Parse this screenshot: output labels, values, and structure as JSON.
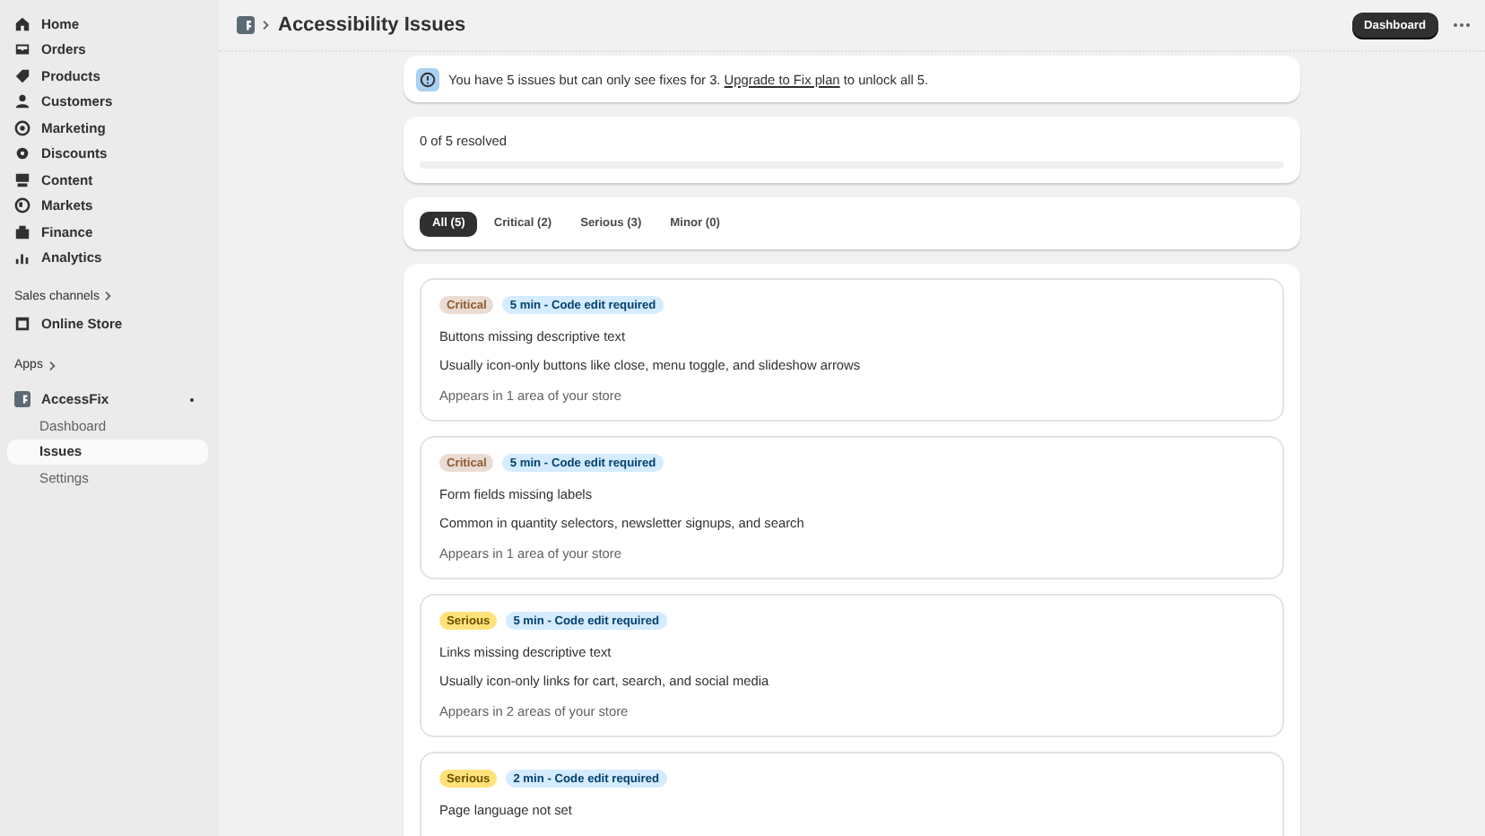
{
  "sidebar": {
    "nav": [
      {
        "label": "Home",
        "selected": false
      },
      {
        "label": "Orders",
        "selected": false
      },
      {
        "label": "Products",
        "selected": false
      },
      {
        "label": "Customers",
        "selected": false
      },
      {
        "label": "Marketing",
        "selected": false
      },
      {
        "label": "Discounts",
        "selected": false
      },
      {
        "label": "Content",
        "selected": false
      },
      {
        "label": "Markets",
        "selected": false
      },
      {
        "label": "Finance",
        "selected": false
      },
      {
        "label": "Analytics",
        "selected": false
      }
    ],
    "sales_channels": {
      "heading": "Sales channels",
      "items": [
        {
          "label": "Online Store",
          "selected": false
        }
      ]
    },
    "apps": {
      "heading": "Apps",
      "app": {
        "label": "AccessFix",
        "children": [
          {
            "label": "Dashboard",
            "selected": false
          },
          {
            "label": "Issues",
            "selected": true
          },
          {
            "label": "Settings",
            "selected": false
          }
        ]
      }
    }
  },
  "header": {
    "title": "Accessibility Issues",
    "button": "Dashboard"
  },
  "banner": {
    "text_before": "You have 5 issues but can only see fixes for 3.",
    "link": "Upgrade to Fix plan",
    "text_after": "to unlock all 5."
  },
  "progress": {
    "label": "0 of 5 resolved",
    "level": 0
  },
  "tabs": [
    {
      "label": "All (5)",
      "selected": true
    },
    {
      "label": "Critical (2)",
      "selected": false
    },
    {
      "label": "Serious (3)",
      "selected": false
    },
    {
      "label": "Minor (0)",
      "selected": false
    }
  ],
  "issues": [
    {
      "severity": {
        "kind": "critical",
        "label": "Critical"
      },
      "effort": "5 min - Code edit required",
      "title": "Buttons missing descriptive text",
      "description": "Usually icon-only buttons like close, menu toggle, and slideshow arrows",
      "scope": "Appears in 1 area of your store"
    },
    {
      "severity": {
        "kind": "critical",
        "label": "Critical"
      },
      "effort": "5 min - Code edit required",
      "title": "Form fields missing labels",
      "description": "Common in quantity selectors, newsletter signups, and search",
      "scope": "Appears in 1 area of your store"
    },
    {
      "severity": {
        "kind": "serious",
        "label": "Serious"
      },
      "effort": "5 min - Code edit required",
      "title": "Links missing descriptive text",
      "description": "Usually icon-only links for cart, search, and social media",
      "scope": "Appears in 2 areas of your store"
    },
    {
      "severity": {
        "kind": "serious",
        "label": "Serious"
      },
      "effort": "2 min - Code edit required",
      "title": "Page language not set"
    }
  ]
}
